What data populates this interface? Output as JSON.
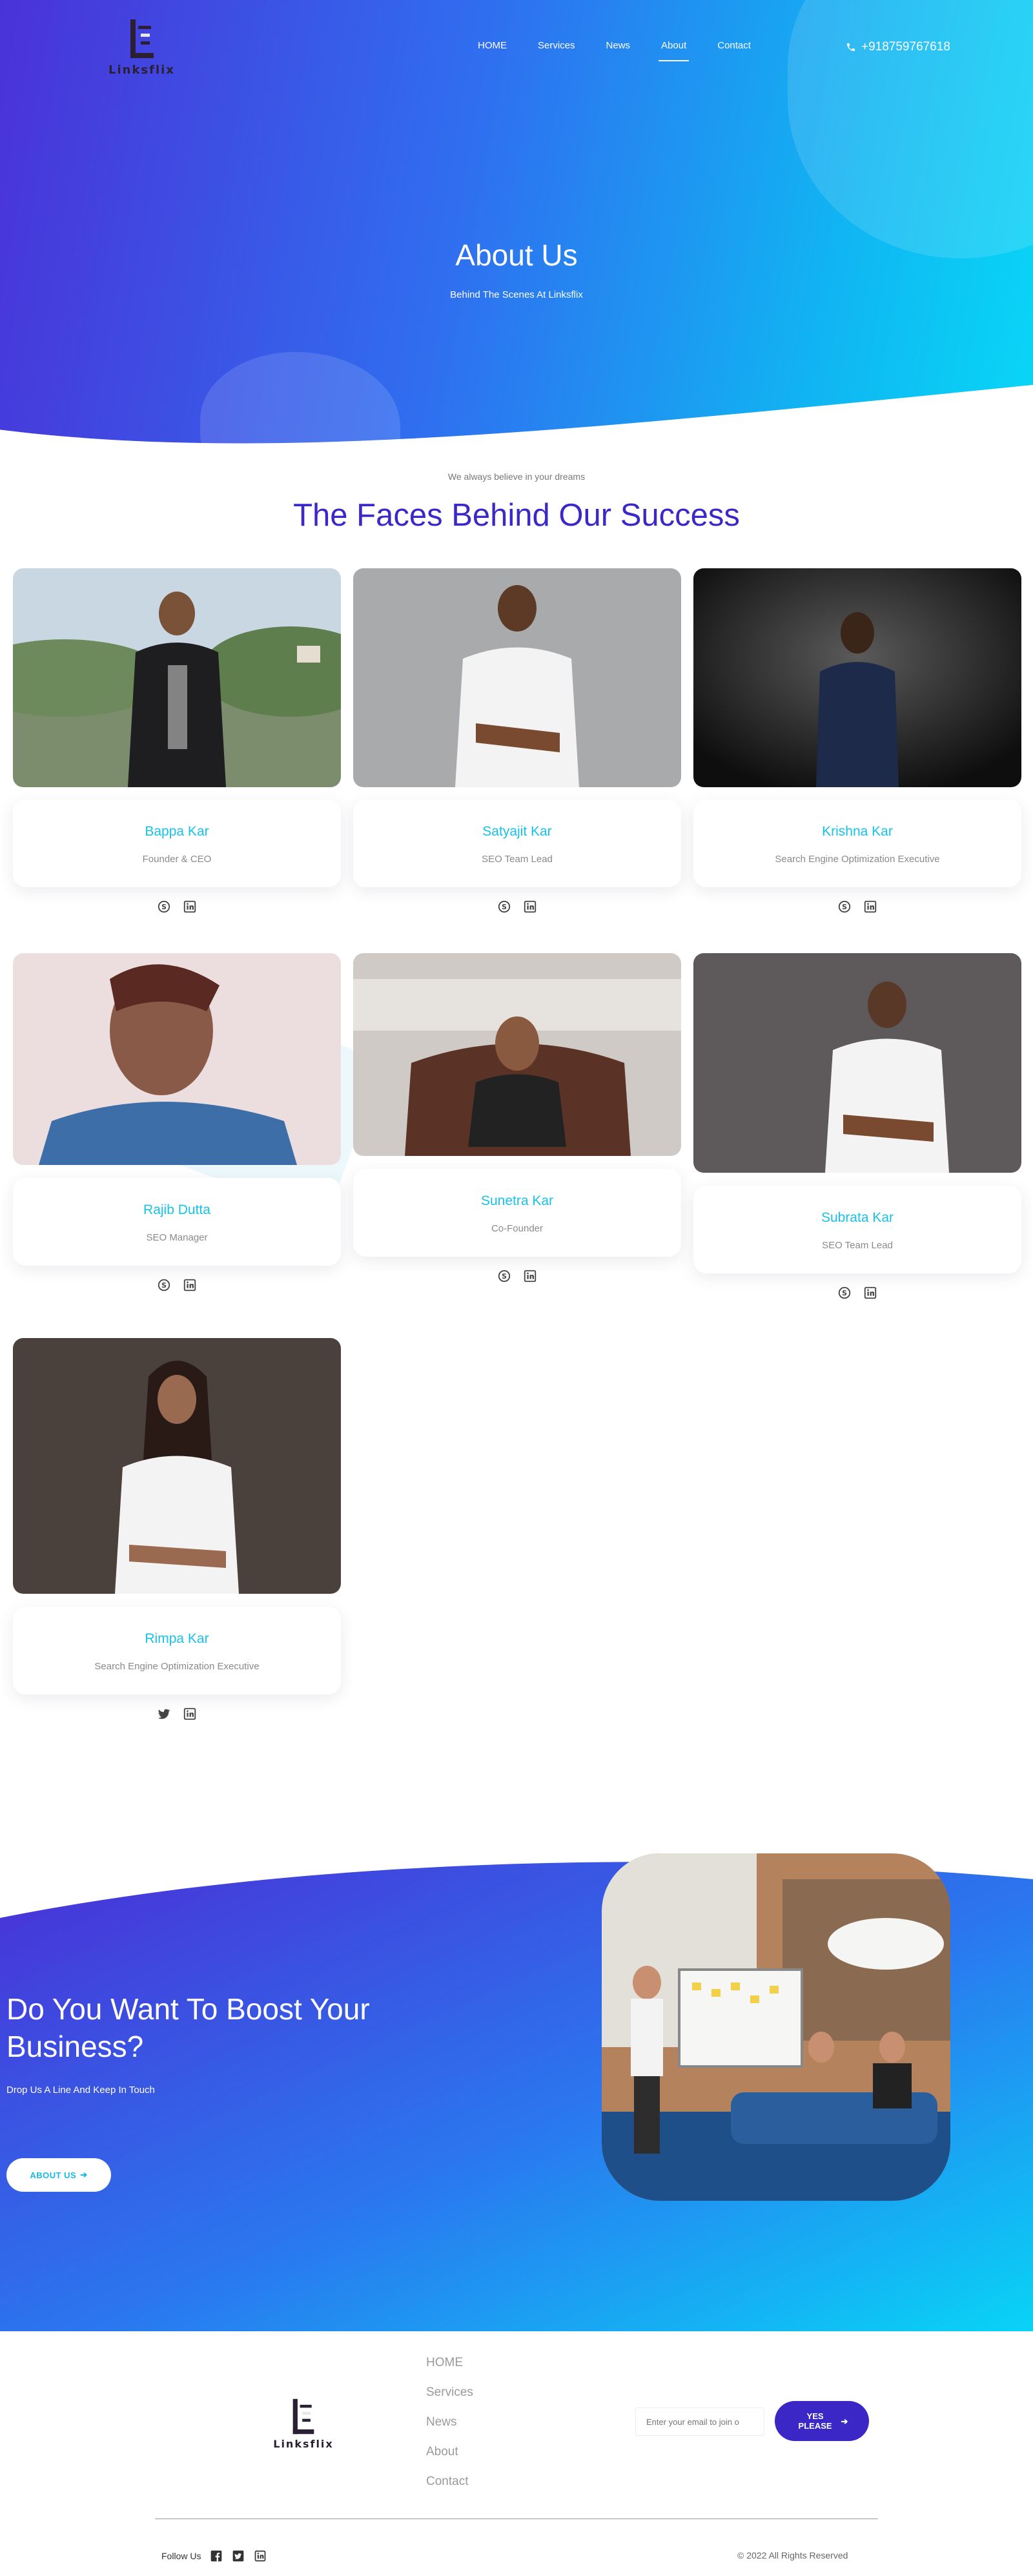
{
  "brand": {
    "name": "Linksflix"
  },
  "nav": {
    "items": [
      "HOME",
      "Services",
      "News",
      "About",
      "Contact"
    ],
    "active": "About"
  },
  "header": {
    "phone": "+918759767618"
  },
  "hero": {
    "title": "About Us",
    "subtitle": "Behind The Scenes At Linksflix"
  },
  "team": {
    "tagline": "We always believe in your dreams",
    "title": "The Faces Behind Our Success",
    "members": [
      {
        "name": "Bappa Kar",
        "role": "Founder & CEO",
        "socials": [
          "skype-icon",
          "linkedin-icon"
        ]
      },
      {
        "name": "Satyajit Kar",
        "role": "SEO Team Lead",
        "socials": [
          "skype-icon",
          "linkedin-icon"
        ]
      },
      {
        "name": "Krishna Kar",
        "role": "Search Engine Optimization Executive",
        "socials": [
          "skype-icon",
          "linkedin-icon"
        ]
      },
      {
        "name": "Rajib Dutta",
        "role": "SEO Manager",
        "socials": [
          "skype-icon",
          "linkedin-icon"
        ]
      },
      {
        "name": "Sunetra Kar",
        "role": "Co-Founder",
        "socials": [
          "skype-icon",
          "linkedin-icon"
        ]
      },
      {
        "name": "Subrata Kar",
        "role": "SEO Team Lead",
        "socials": [
          "skype-icon",
          "linkedin-icon"
        ]
      },
      {
        "name": "Rimpa Kar",
        "role": "Search Engine Optimization Executive",
        "socials": [
          "twitter-icon",
          "linkedin-icon"
        ]
      }
    ]
  },
  "cta": {
    "title": "Do You Want To Boost Your Business?",
    "subtitle": "Drop Us A Line And Keep In Touch",
    "button_label": "ABOUT US"
  },
  "footer": {
    "links": [
      "HOME",
      "Services",
      "News",
      "About",
      "Contact"
    ],
    "email_placeholder": "Enter your email to join o",
    "subscribe_label": "YES PLEASE",
    "follow_label": "Follow Us",
    "social_icons": [
      "facebook-icon",
      "twitter-icon",
      "linkedin-icon"
    ],
    "copyright": "© 2022 All Rights Reserved"
  },
  "colors": {
    "brand_purple": "#3b28c8",
    "accent_cyan": "#17c2e8",
    "gradient_start": "#4a32d8",
    "gradient_end": "#08d7f6"
  }
}
